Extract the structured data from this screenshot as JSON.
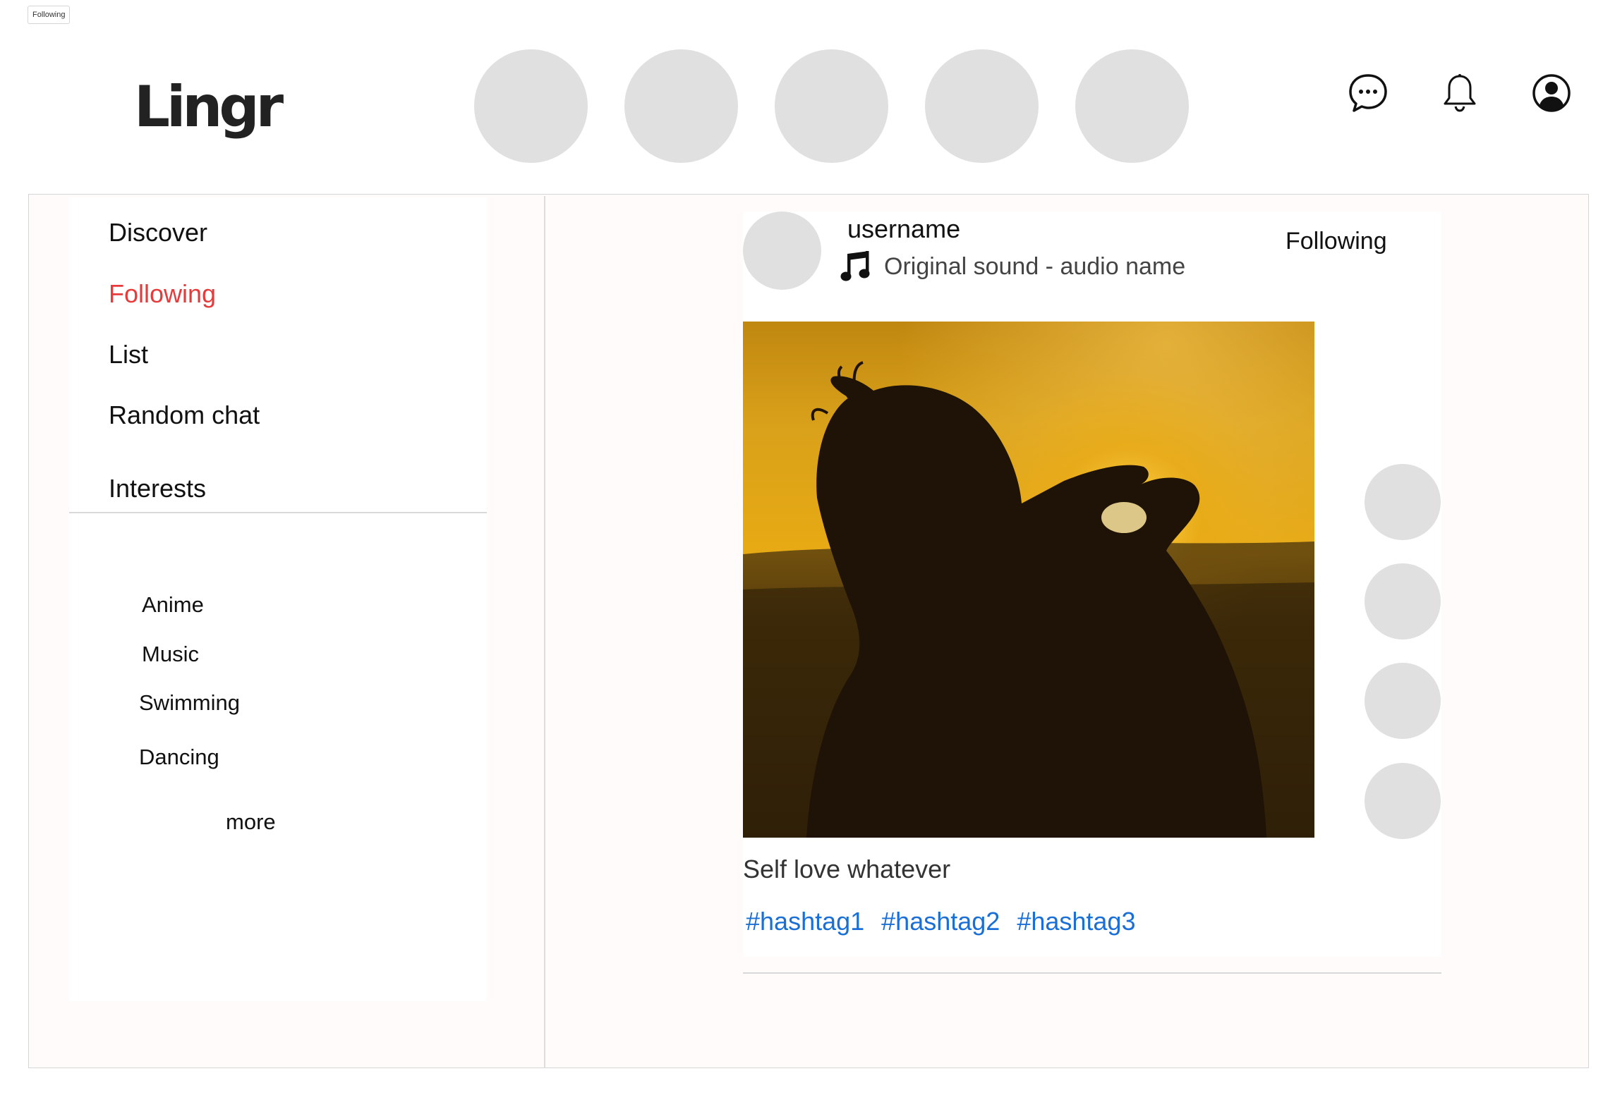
{
  "frame_label": "Following",
  "header": {
    "logo": "Lingr",
    "stories": [
      {
        "id": 1
      },
      {
        "id": 2
      },
      {
        "id": 3
      },
      {
        "id": 4
      },
      {
        "id": 5
      }
    ],
    "icons": [
      "chat-bubble-icon",
      "bell-icon",
      "user-profile-icon"
    ]
  },
  "sidebar": {
    "nav": [
      {
        "label": "Discover",
        "active": false
      },
      {
        "label": "Following",
        "active": true
      },
      {
        "label": "List",
        "active": false
      },
      {
        "label": "Random chat",
        "active": false
      },
      {
        "label": "Interests",
        "active": false
      }
    ],
    "interests": [
      "Anime",
      "Music",
      "Swimming",
      "Dancing"
    ],
    "more_label": "more"
  },
  "post": {
    "username": "username",
    "sound": "Original sound - audio name",
    "follow_status": "Following",
    "caption": "Self love whatever",
    "hashtags": [
      "#hashtag1",
      "#hashtag2",
      "#hashtag3"
    ],
    "action_count": 4
  },
  "colors": {
    "accent_active": "#e83a3a",
    "hashtag": "#1a6fd6",
    "placeholder": "#e0e0e0",
    "panel_bg": "#fefbfa"
  }
}
